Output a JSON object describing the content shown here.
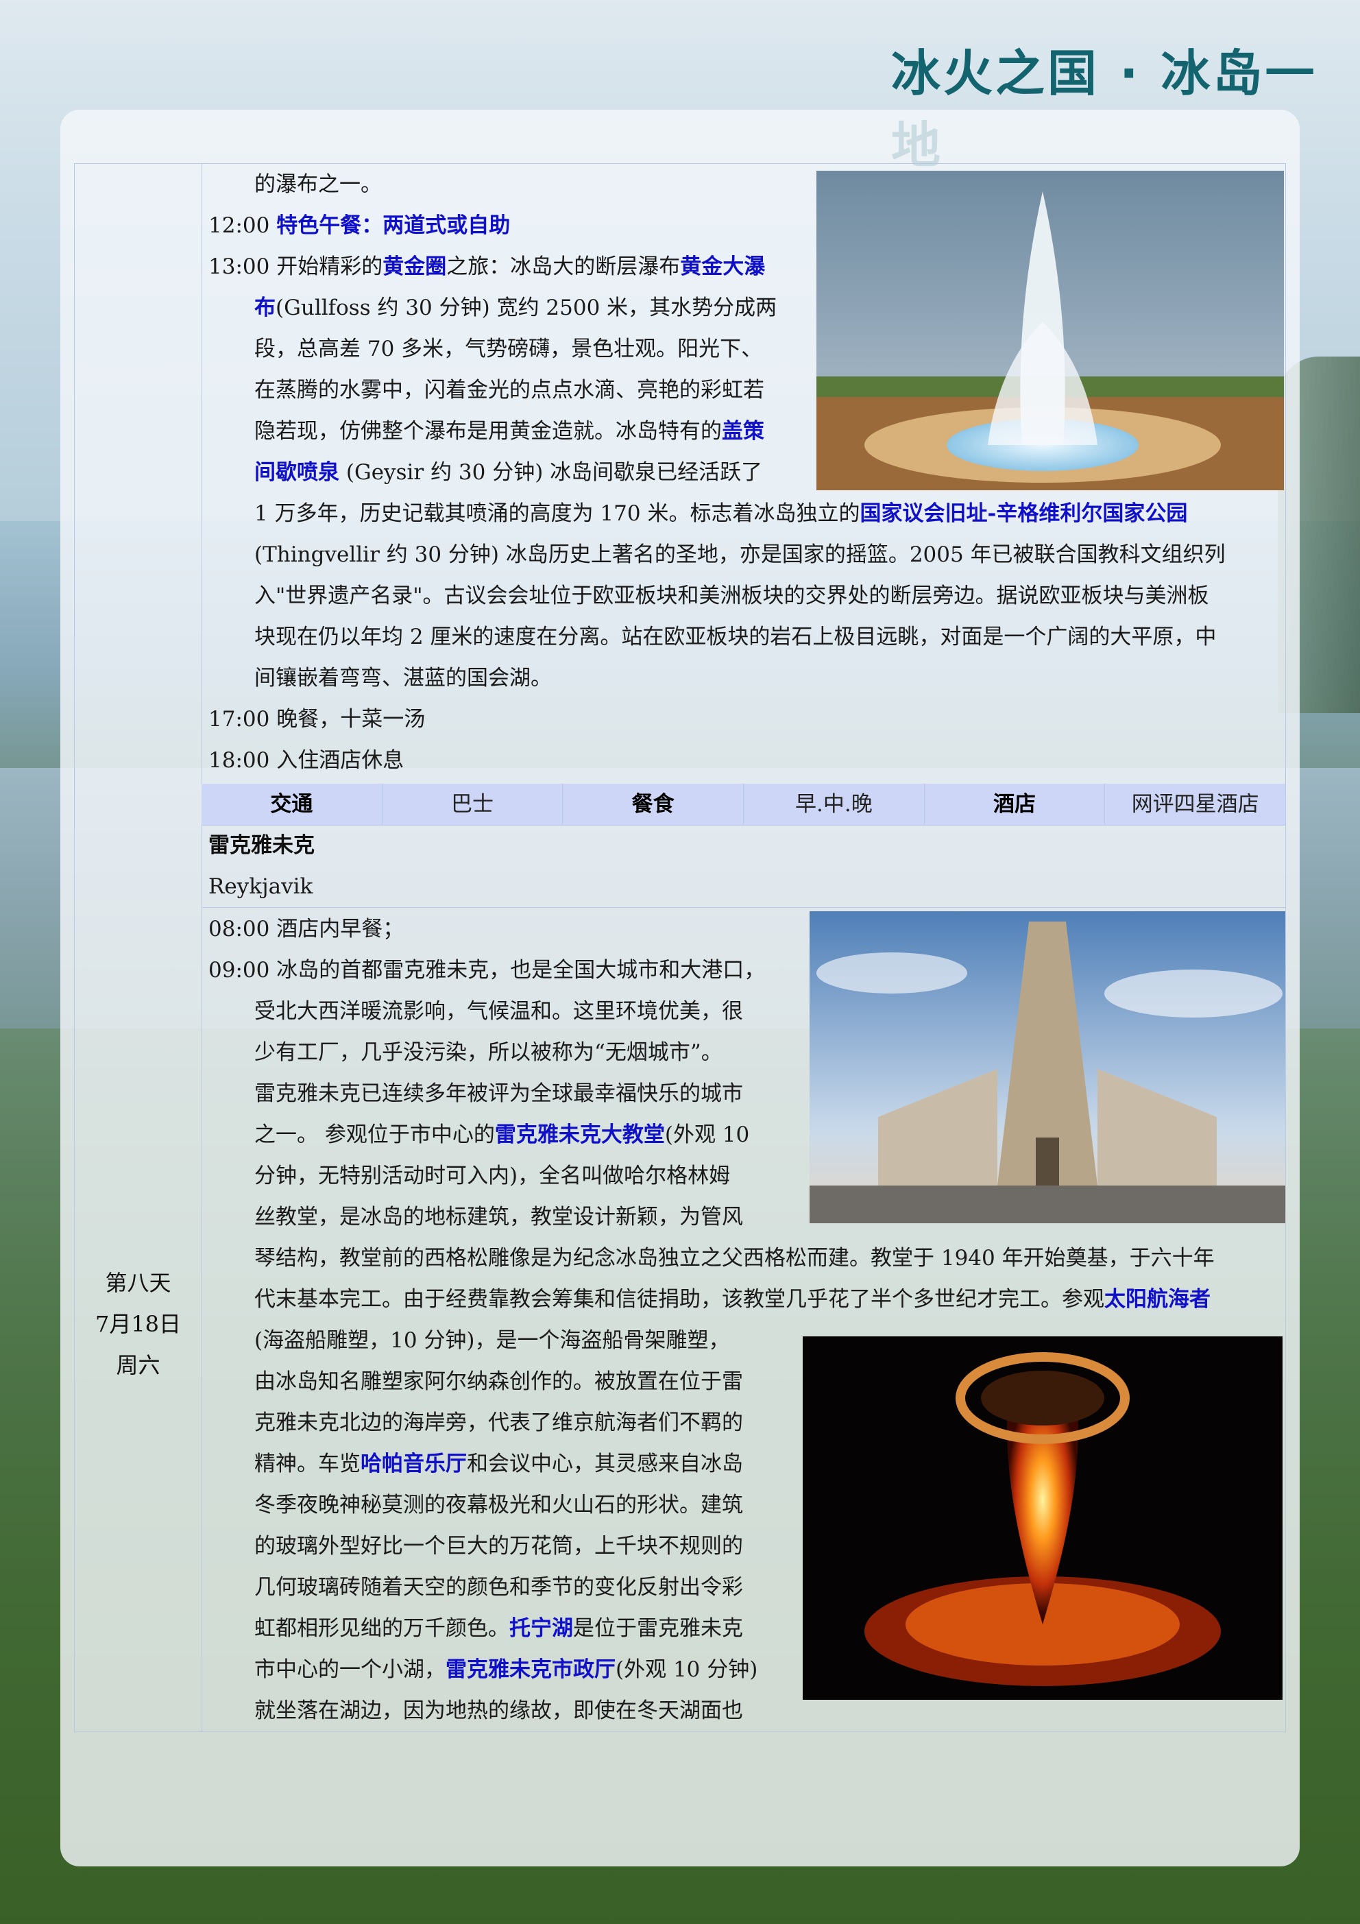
{
  "header": {
    "title": "冰火之国 · 冰岛一地"
  },
  "day": {
    "name": "第八天",
    "date": "7月18日",
    "weekday": "周六"
  },
  "prev": {
    "l1": "的瀑布之一。",
    "t1": "12:00",
    "t1_link": "特色午餐：两道式或自助",
    "t2": "13:00",
    "t2_a": "开始精彩的",
    "t2_link1": "黄金圈",
    "t2_b": "之旅：冰岛大的断层瀑布",
    "t2_link2": "黄金大瀑",
    "l3_link": "布",
    "l3": "(Gullfoss 约 30 分钟) 宽约 2500 米，其水势分成两",
    "l4": "段，总高差 70 多米，气势磅礴，景色壮观。阳光下、",
    "l5": "在蒸腾的水雾中，闪着金光的点点水滴、亮艳的彩虹若",
    "l6_a": "隐若现，仿佛整个瀑布是用黄金造就。冰岛特有的",
    "l6_link": "盖策",
    "l7_link": "间歇喷泉",
    "l7": " (Geysir 约 30 分钟) 冰岛间歇泉已经活跃了",
    "l8_a": "1 万多年，历史记载其喷涌的高度为 170 米。标志着冰岛独立的",
    "l8_link": "国家议会旧址-辛格维利尔国家公园",
    "l9": "(Thingvellir 约 30 分钟) 冰岛历史上著名的圣地，亦是国家的摇篮。2005 年已被联合国教科文组织列",
    "l10": "入\"世界遗产名录\"。古议会会址位于欧亚板块和美洲板块的交界处的断层旁边。据说欧亚板块与美洲板",
    "l11": "块现在仍以年均 2 厘米的速度在分离。站在欧亚板块的岩石上极目远眺，对面是一个广阔的大平原，中",
    "l12": "间镶嵌着弯弯、湛蓝的国会湖。",
    "l13": "17:00 晚餐，十菜一汤",
    "l14": "18:00 入住酒店休息"
  },
  "info_row": [
    "交通",
    "巴士",
    "餐食",
    "早.中.晚",
    "酒店",
    "网评四星酒店"
  ],
  "city": {
    "zh": "雷克雅未克",
    "en": "Reykjavik"
  },
  "day8": {
    "l1": "08:00 酒店内早餐；",
    "l2": "09:00 冰岛的首都雷克雅未克，也是全国大城市和大港口，",
    "l3": "受北大西洋暖流影响，气候温和。这里环境优美，很",
    "l4": "少有工厂，几乎没污染，所以被称为“无烟城市”。",
    "l5": "雷克雅未克已连续多年被评为全球最幸福快乐的城市",
    "l6_a": "之一。 参观位于市中心的",
    "l6_link": "雷克雅未克大教堂",
    "l6_b": "(外观 10",
    "l7": "分钟，无特别活动时可入内)，全名叫做哈尔格林姆",
    "l8": "丝教堂，是冰岛的地标建筑，教堂设计新颖，为管风",
    "l9": "琴结构，教堂前的西格松雕像是为纪念冰岛独立之父西格松而建。教堂于 1940 年开始奠基，于六十年",
    "l10_a": "代末基本完工。由于经费靠教会筹集和信徒捐助，该教堂几乎花了半个多世纪才完工。参观",
    "l10_link": "太阳航海者",
    "l11": "(海盗船雕塑，10 分钟)，是一个海盗船骨架雕塑，",
    "l12": "由冰岛知名雕塑家阿尔纳森创作的。被放置在位于雷",
    "l13": "克雅未克北边的海岸旁，代表了维京航海者们不羁的",
    "l14_a": "精神。车览",
    "l14_link": "哈帕音乐厅",
    "l14_b": "和会议中心，其灵感来自冰岛",
    "l15": "冬季夜晚神秘莫测的夜幕极光和火山石的形状。建筑",
    "l16": "的玻璃外型好比一个巨大的万花筒，上千块不规则的",
    "l17": "几何玻璃砖随着天空的颜色和季节的变化反射出令彩",
    "l18_a": "虹都相形见绌的万千颜色。",
    "l18_link": "托宁湖",
    "l18_b": "是位于雷克雅未克",
    "l19_a": "市中心的一个小湖，",
    "l19_link": "雷克雅未克市政厅",
    "l19_b": "(外观 10 分钟)",
    "l20": "就坐落在湖边，因为地热的缘故，即使在冬天湖面也"
  }
}
